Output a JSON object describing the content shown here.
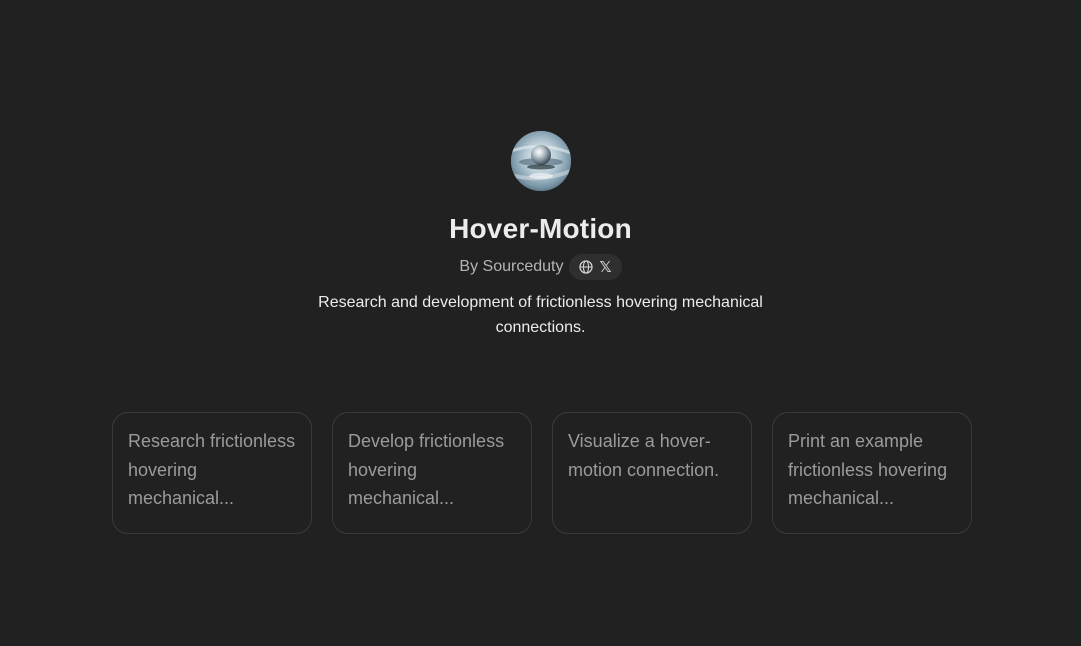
{
  "gpt": {
    "title": "Hover-Motion",
    "author": "By Sourceduty",
    "description": "Research and development of frictionless hovering mechanical connections.",
    "links": [
      {
        "icon": "globe-icon"
      },
      {
        "icon": "x-logo-icon",
        "glyph": "𝕏"
      }
    ]
  },
  "conversation_starters": [
    {
      "label": "Research frictionless hovering mechanical..."
    },
    {
      "label": "Develop frictionless hovering mechanical..."
    },
    {
      "label": "Visualize a hover-motion connection."
    },
    {
      "label": "Print an example frictionless hovering mechanical..."
    }
  ],
  "colors": {
    "background": "#212121",
    "card_border": "#3a3a3a",
    "pill_background": "#2f2f2f"
  }
}
